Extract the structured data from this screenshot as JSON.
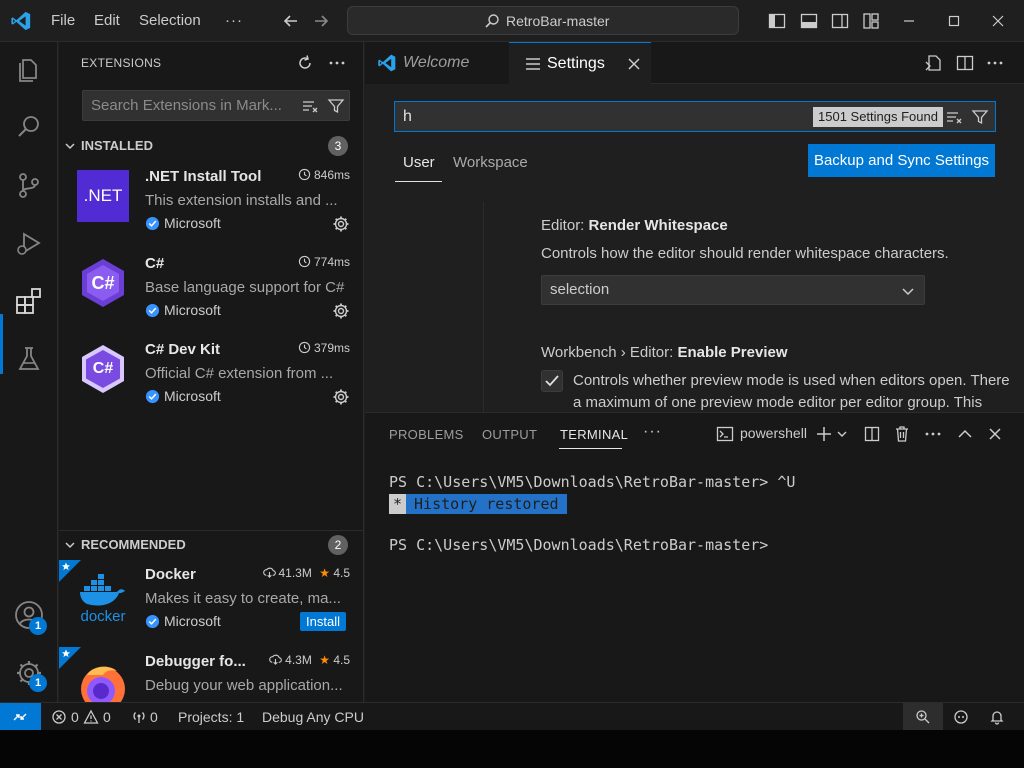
{
  "titlebar": {
    "menu": [
      "File",
      "Edit",
      "Selection"
    ],
    "more": "···",
    "search_text": "RetroBar-master",
    "icons": [
      "vscode-logo",
      "back-arrow",
      "forward-arrow",
      "search",
      "toggle-primary-sidebar",
      "toggle-panel",
      "toggle-secondary-sidebar",
      "customize-layout",
      "minimize",
      "maximize",
      "close"
    ]
  },
  "activity_bar": {
    "items": [
      "explorer",
      "search",
      "source-control",
      "run-and-debug",
      "extensions",
      "testing"
    ],
    "active": "extensions",
    "account_badge": "1",
    "manage_badge": "1"
  },
  "sidebar": {
    "title": "EXTENSIONS",
    "search_placeholder": "Search Extensions in Mark...",
    "installed": {
      "label": "INSTALLED",
      "count": "3",
      "items": [
        {
          "name": ".NET Install Tool",
          "time": "846ms",
          "description": "This extension installs and ...",
          "publisher": "Microsoft",
          "logo_text": ".NET"
        },
        {
          "name": "C#",
          "time": "774ms",
          "description": "Base language support for C#",
          "publisher": "Microsoft",
          "logo_text": "C#"
        },
        {
          "name": "C# Dev Kit",
          "time": "379ms",
          "description": "Official C# extension from ...",
          "publisher": "Microsoft",
          "logo_text": "C#"
        }
      ]
    },
    "recommended": {
      "label": "RECOMMENDED",
      "count": "2",
      "items": [
        {
          "name": "Docker",
          "downloads": "41.3M",
          "rating": "4.5",
          "description": "Makes it easy to create, ma...",
          "publisher": "Microsoft",
          "action": "Install",
          "logo_text": "docker"
        },
        {
          "name": "Debugger fo...",
          "downloads": "4.3M",
          "rating": "4.5",
          "description": "Debug your web application..."
        }
      ]
    }
  },
  "editor": {
    "tabs": [
      {
        "label": "Welcome",
        "icon": "vscode-icon",
        "active": false
      },
      {
        "label": "Settings",
        "icon": "settings-lines-icon",
        "active": true
      }
    ],
    "settings": {
      "query": "h",
      "found": "1501 Settings Found",
      "scopes": [
        "User",
        "Workspace"
      ],
      "active_scope": "User",
      "sync_button": "Backup and Sync Settings",
      "items": [
        {
          "category": "Editor: ",
          "name": "Render Whitespace",
          "description": "Controls how the editor should render whitespace characters.",
          "value": "selection"
        },
        {
          "category": "Workbench › Editor: ",
          "name": "Enable Preview",
          "description_line1": "Controls whether preview mode is used when editors open. There",
          "description_line2": "a maximum of one preview mode editor per editor group. This",
          "checked": true
        }
      ]
    }
  },
  "panel": {
    "tabs": [
      "PROBLEMS",
      "OUTPUT",
      "TERMINAL"
    ],
    "active_tab": "TERMINAL",
    "more": "···",
    "shell": "powershell",
    "terminal": {
      "line1": "PS C:\\Users\\VM5\\Downloads\\RetroBar-master> ^U",
      "history_mark": "*",
      "history_text": "History restored",
      "line3": "PS C:\\Users\\VM5\\Downloads\\RetroBar-master>"
    }
  },
  "statusbar": {
    "errors": "0",
    "warnings": "0",
    "ports": "0",
    "projects": "Projects: 1",
    "config": "Debug Any CPU"
  },
  "colors": {
    "accent": "#0078d4",
    "background": "#1f1f1f",
    "sidebar": "#181818"
  }
}
